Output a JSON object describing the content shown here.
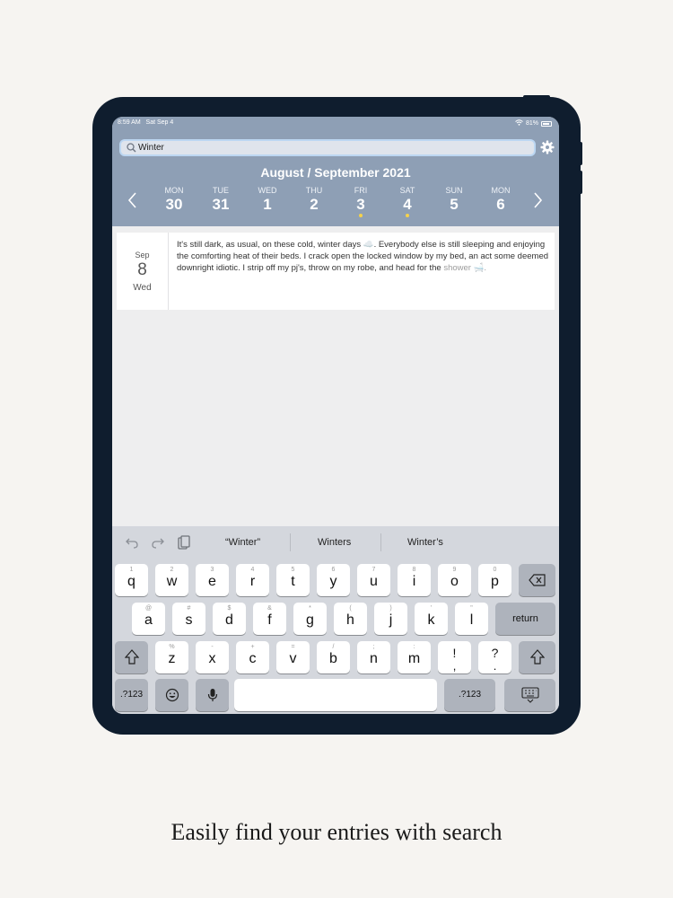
{
  "status_bar": {
    "time": "8:59 AM",
    "date": "Sat Sep 4",
    "battery": "81%"
  },
  "search": {
    "value": "Winter"
  },
  "calendar": {
    "title": "August / September 2021",
    "days": [
      {
        "name": "MON",
        "num": "30",
        "has_entry": false
      },
      {
        "name": "TUE",
        "num": "31",
        "has_entry": false
      },
      {
        "name": "WED",
        "num": "1",
        "has_entry": false
      },
      {
        "name": "THU",
        "num": "2",
        "has_entry": false
      },
      {
        "name": "FRI",
        "num": "3",
        "has_entry": true
      },
      {
        "name": "SAT",
        "num": "4",
        "has_entry": true
      },
      {
        "name": "SUN",
        "num": "5",
        "has_entry": false
      },
      {
        "name": "MON",
        "num": "6",
        "has_entry": false
      }
    ]
  },
  "entry": {
    "month": "Sep",
    "day": "8",
    "weekday": "Wed",
    "text": "It's still dark, as usual, on these cold, winter days ☁️. Everybody else is still sleeping and enjoying the comforting heat of their beds. I crack open the locked window by my bed, an act some deemed downright idiotic. I strip off my pj's, throw on my robe, and head for the",
    "text_fade": "shower 🛁."
  },
  "keyboard": {
    "suggestions": [
      "“Winter”",
      "Winters",
      "Winter’s"
    ],
    "row1": [
      [
        "1",
        "q"
      ],
      [
        "2",
        "w"
      ],
      [
        "3",
        "e"
      ],
      [
        "4",
        "r"
      ],
      [
        "5",
        "t"
      ],
      [
        "6",
        "y"
      ],
      [
        "7",
        "u"
      ],
      [
        "8",
        "i"
      ],
      [
        "9",
        "o"
      ],
      [
        "0",
        "p"
      ]
    ],
    "row2": [
      [
        "@",
        "a"
      ],
      [
        "#",
        "s"
      ],
      [
        "$",
        "d"
      ],
      [
        "&",
        "f"
      ],
      [
        "*",
        "g"
      ],
      [
        "(",
        "h"
      ],
      [
        ")",
        "j"
      ],
      [
        "'",
        "k"
      ],
      [
        "\"",
        "l"
      ]
    ],
    "row3": [
      [
        "%",
        "z"
      ],
      [
        "-",
        "x"
      ],
      [
        "+",
        "c"
      ],
      [
        "=",
        "v"
      ],
      [
        "/",
        "b"
      ],
      [
        ";",
        "n"
      ],
      [
        ":",
        "m"
      ],
      [
        "",
        "!"
      ],
      [
        "",
        "?"
      ]
    ],
    "row3_sub": [
      ",",
      "."
    ],
    "return_label": "return",
    "numbers_label": ".?123"
  },
  "caption": "Easily find your entries with search",
  "colors": {
    "header": "#8e9fb5",
    "device": "#0f1d2e",
    "dot": "#f6d24a"
  }
}
